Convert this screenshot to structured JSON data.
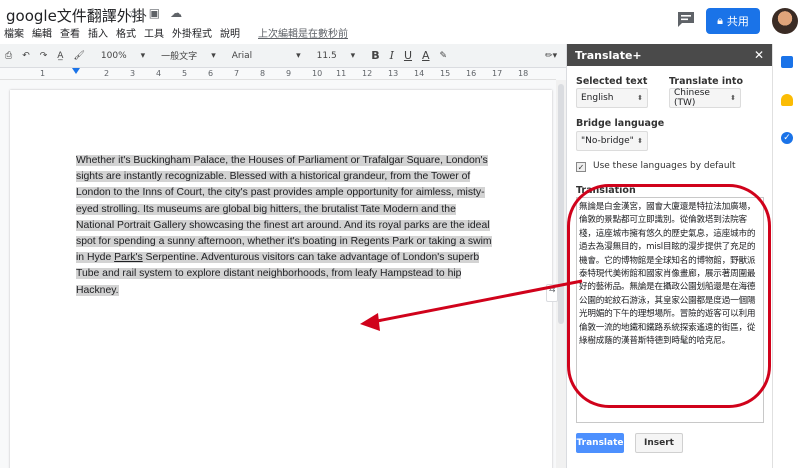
{
  "header": {
    "doc_title": "google文件翻譯外掛",
    "menu": [
      "檔案",
      "編輯",
      "查看",
      "插入",
      "格式",
      "工具",
      "外掛程式",
      "說明"
    ],
    "last_edit": "上次編輯是在數秒前",
    "share_label": "共用"
  },
  "toolbar": {
    "zoom": "100%",
    "style": "一般文字",
    "font": "Arial",
    "font_size": "11.5",
    "bold": "B",
    "italic": "I",
    "underline": "U",
    "text_color": "A"
  },
  "ruler": [
    "1",
    "2",
    "3",
    "4",
    "5",
    "6",
    "7",
    "8",
    "9",
    "10",
    "11",
    "12",
    "13",
    "14",
    "15",
    "16",
    "17",
    "18"
  ],
  "document": {
    "text_before": "Whether it's Buckingham Palace, the Houses of Parliament or Trafalgar Square, London's sights are instantly recognizable. Blessed with a historical grandeur, from the Tower of London to the Inns of Court, the city's past provides ample opportunity for aimless, misty-eyed strolling. Its museums are global big hitters, the brutalist Tate Modern and the National Portrait Gallery showcasing the finest art around. And its royal parks are the ideal spot for spending a sunny afternoon, whether it's boating in Regents Park or taking a swim in Hyde ",
    "text_link": "Park's",
    "text_after": " Serpentine. Adventurous visitors can take advantage of London's superb Tube and rail system to explore distant neighborhoods, from leafy Hampstead to hip Hackney."
  },
  "sidebar": {
    "title": "Translate+",
    "selected_text_label": "Selected text",
    "selected_text_value": "English",
    "translate_into_label": "Translate into",
    "translate_into_value": "Chinese (TW)",
    "bridge_label": "Bridge language",
    "bridge_value": "\"No-bridge\"",
    "default_checkbox_label": "Use these languages by default",
    "translation_label": "Translation",
    "translation_text": "無論是白金漢宮，國會大廈還是特拉法加廣場，倫敦的景點都可立即識別。從倫敦塔到法院客棧，這座城市擁有悠久的歷史氣息，這座城市的過去為漫無目的，misl目眩的漫步提供了充足的機會。它的博物館是全球知名的博物館，野獸派泰特現代美術館和國家肖像畫廊，展示著周圍最好的藝術品。無論是在攝政公園划船還是在海德公園的蛇紋石游泳，其皇家公園都是度過一個陽光明媚的下午的理想場所。冒險的遊客可以利用倫敦一流的地鐵和鐵路系統探索遙遠的街區，從綠樹成蔭的漢普斯特德到時髦的哈克尼。",
    "translate_button": "Translate",
    "insert_button": "Insert"
  },
  "colors": {
    "share_button": "#1a73e8",
    "sidebar_header": "#4a4a4a",
    "translate_button": "#4d90fe",
    "annotation_red": "#d0021b"
  }
}
